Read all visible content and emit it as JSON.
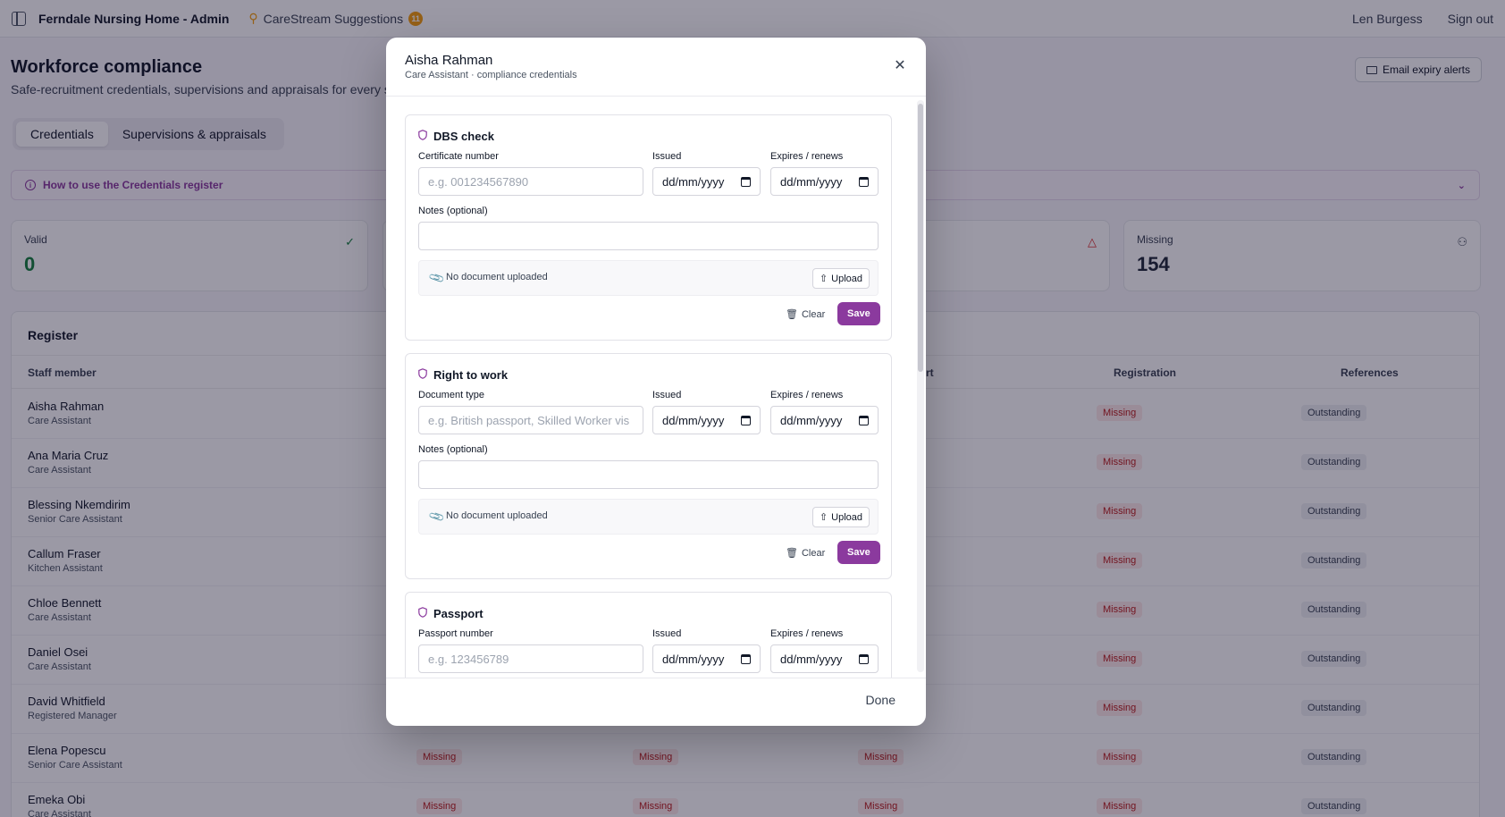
{
  "topbar": {
    "app_title": "Ferndale Nursing Home - Admin",
    "suggestions_label": "CareStream Suggestions",
    "suggestions_count": "11",
    "user": "Len Burgess",
    "sign_out": "Sign out"
  },
  "page": {
    "title": "Workforce compliance",
    "subtitle": "Safe-recruitment credentials, supervisions and appraisals for every sta",
    "email_alerts": "Email expiry alerts",
    "tabs": [
      "Credentials",
      "Supervisions & appraisals"
    ],
    "howto": "How to use the Credentials register"
  },
  "stats": [
    {
      "label": "Valid",
      "value": "0",
      "color": "#15803d"
    },
    {
      "label": "Missing",
      "value": "154",
      "color": "#1f2937"
    }
  ],
  "register": {
    "title": "Register",
    "headers": {
      "staff": "Staff member",
      "passport_tail": "rt",
      "registration": "Registration",
      "references": "References"
    },
    "status_missing": "Missing",
    "status_outstanding": "Outstanding",
    "rows": [
      {
        "name": "Aisha Rahman",
        "role": "Care Assistant"
      },
      {
        "name": "Ana Maria Cruz",
        "role": "Care Assistant"
      },
      {
        "name": "Blessing Nkemdirim",
        "role": "Senior Care Assistant"
      },
      {
        "name": "Callum Fraser",
        "role": "Kitchen Assistant"
      },
      {
        "name": "Chloe Bennett",
        "role": "Care Assistant"
      },
      {
        "name": "Daniel Osei",
        "role": "Care Assistant"
      },
      {
        "name": "David Whitfield",
        "role": "Registered Manager"
      },
      {
        "name": "Elena Popescu",
        "role": "Senior Care Assistant"
      },
      {
        "name": "Emeka Obi",
        "role": "Care Assistant"
      }
    ]
  },
  "modal": {
    "title": "Aisha Rahman",
    "subtitle": "Care Assistant · compliance credentials",
    "done": "Done",
    "issued_label": "Issued",
    "expires_label": "Expires / renews",
    "date_placeholder": "dd/mm/yyyy",
    "notes_label": "Notes (optional)",
    "no_document": "No document uploaded",
    "upload": "Upload",
    "clear": "Clear",
    "save": "Save",
    "sections": [
      {
        "title": "DBS check",
        "field_label": "Certificate number",
        "placeholder": "e.g. 001234567890"
      },
      {
        "title": "Right to work",
        "field_label": "Document type",
        "placeholder": "e.g. British passport, Skilled Worker vis"
      },
      {
        "title": "Passport",
        "field_label": "Passport number",
        "placeholder": "e.g. 123456789"
      }
    ]
  },
  "colors": {
    "accent": "#8b3a9e",
    "missing_bg": "#fde8e8",
    "missing_text": "#b91c1c"
  }
}
